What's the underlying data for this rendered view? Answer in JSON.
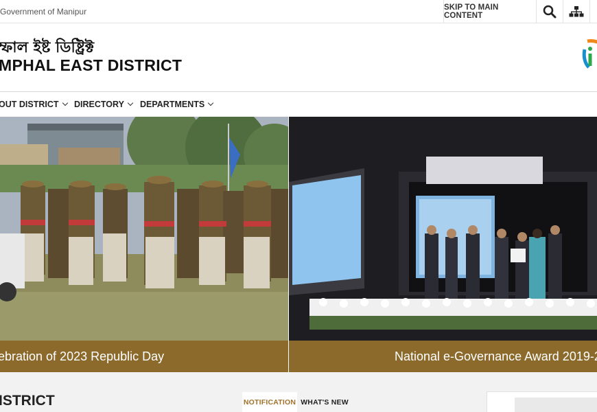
{
  "topbar": {
    "government": "Government of Manipur",
    "skip_label": "SKIP TO MAIN CONTENT",
    "search_icon": "search-icon",
    "sitemap_icon": "sitemap-icon"
  },
  "header": {
    "native_title": "ম্ফাল ইষ্ট ডিষ্ট্রিক্ট",
    "title": "MPHAL EAST DISTRICT",
    "logo_icon": "digital-india-logo"
  },
  "nav": {
    "items": [
      {
        "label": "OUT DISTRICT"
      },
      {
        "label": "DIRECTORY"
      },
      {
        "label": "DEPARTMENTS"
      }
    ]
  },
  "slides": [
    {
      "caption": "ebration of 2023 Republic Day"
    },
    {
      "caption": "National e-Governance Award 2019-2"
    }
  ],
  "colors": {
    "caption_bg": "#8c6a2b",
    "notification_tab": "#a0722b"
  },
  "below": {
    "heading": "ISTRICT",
    "tabs": [
      {
        "label": "NOTIFICATION"
      },
      {
        "label": "WHAT'S NEW"
      }
    ]
  }
}
